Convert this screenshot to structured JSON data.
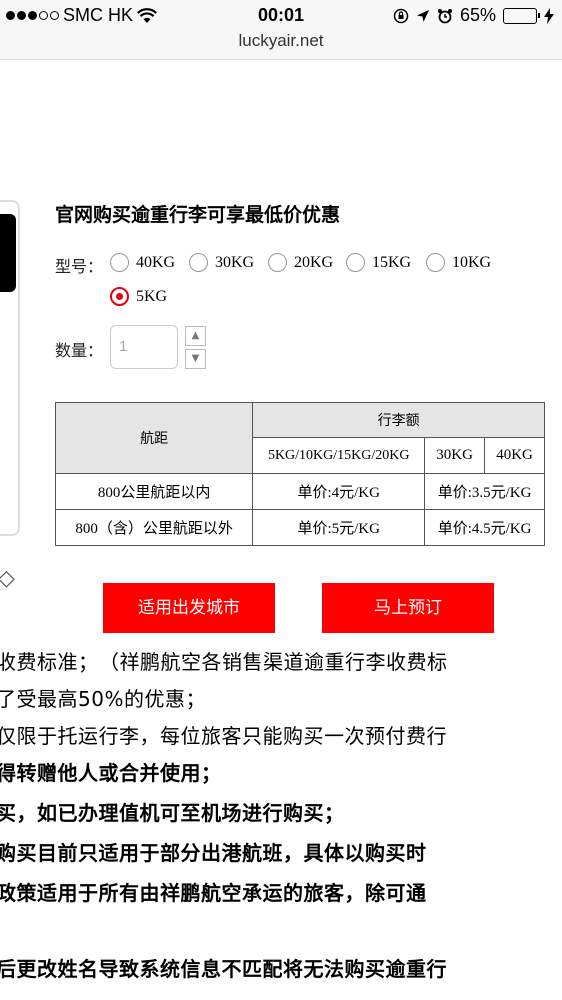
{
  "status_bar": {
    "carrier": "SMC HK",
    "time": "00:01",
    "battery": "65%",
    "battery_level": 0.65
  },
  "browser": {
    "url": "luckyair.net"
  },
  "main": {
    "title": "官网购买逾重行李可享最低价优惠",
    "type_label": "型号：",
    "options": [
      {
        "label": "40KG",
        "selected": false
      },
      {
        "label": "30KG",
        "selected": false
      },
      {
        "label": "20KG",
        "selected": false
      },
      {
        "label": "15KG",
        "selected": false
      },
      {
        "label": "10KG",
        "selected": false
      },
      {
        "label": "5KG",
        "selected": true
      }
    ],
    "qty_label": "数量：",
    "qty_placeholder": "1",
    "table": {
      "h_distance": "航距",
      "h_amount": "行李额",
      "sub_headers": [
        "5KG/10KG/15KG/20KG",
        "30KG",
        "40KG"
      ],
      "rows": [
        {
          "distance": "800公里航距以内",
          "price_a": "单价:4元/KG",
          "price_b": "单价:3.5元/KG"
        },
        {
          "distance": "800（含）公里航距以外",
          "price_a": "单价:5元/KG",
          "price_b": "单价:4.5元/KG"
        }
      ]
    },
    "btn_city": "适用出发城市",
    "btn_book": "马上预订"
  },
  "rules": [
    {
      "text": "收费标准；　（祥鹏航空各销售渠道逾重行李收费标",
      "bold": false
    },
    {
      "text": "了受最高50%的优惠；",
      "bold": false
    },
    {
      "text": "仅限于托运行李，每位旅客只能购买一次预付费行",
      "bold": false
    },
    {
      "text": "得转赠他人或合并使用；",
      "bold": true
    },
    {
      "text": "买，如已办理值机可至机场进行购买；",
      "bold": true
    },
    {
      "text": "购买目前只适用于部分出港航班，具体以购买时",
      "bold": true
    },
    {
      "text": "政策适用于所有由祥鹏航空承运的旅客，除可通",
      "bold": true
    },
    {
      "text": "后更改姓名导致系统信息不匹配将无法购买逾重行",
      "bold": true
    }
  ]
}
